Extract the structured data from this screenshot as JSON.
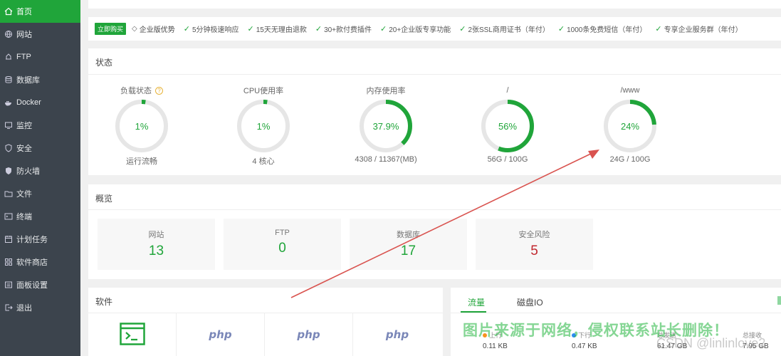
{
  "sidebar": {
    "items": [
      {
        "label": "首页",
        "icon": "home-icon",
        "active": true
      },
      {
        "label": "网站",
        "icon": "globe-icon"
      },
      {
        "label": "FTP",
        "icon": "ftp-icon"
      },
      {
        "label": "数据库",
        "icon": "database-icon"
      },
      {
        "label": "Docker",
        "icon": "docker-icon"
      },
      {
        "label": "监控",
        "icon": "monitor-icon"
      },
      {
        "label": "安全",
        "icon": "shield-icon"
      },
      {
        "label": "防火墙",
        "icon": "firewall-icon"
      },
      {
        "label": "文件",
        "icon": "folder-icon"
      },
      {
        "label": "终端",
        "icon": "terminal-icon"
      },
      {
        "label": "计划任务",
        "icon": "calendar-icon"
      },
      {
        "label": "软件商店",
        "icon": "apps-icon"
      },
      {
        "label": "面板设置",
        "icon": "settings-icon"
      },
      {
        "label": "退出",
        "icon": "logout-icon"
      }
    ]
  },
  "promo": {
    "buy_label": "立即购买",
    "enterprise_label": "企业版优势",
    "features": [
      "5分钟极速响应",
      "15天无理由退款",
      "30+款付费插件",
      "20+企业版专享功能",
      "2张SSL商用证书（年付）",
      "1000条免费短信（年付）",
      "专享企业服务群（年付）"
    ]
  },
  "status": {
    "title": "状态",
    "gauges": [
      {
        "label": "负载状态",
        "value": "1%",
        "percent": 1,
        "sub": "运行流畅",
        "help": "?"
      },
      {
        "label": "CPU使用率",
        "value": "1%",
        "percent": 1,
        "sub": "4 核心"
      },
      {
        "label": "内存使用率",
        "value": "37.9%",
        "percent": 37.9,
        "sub": "4308 / 11367(MB)"
      },
      {
        "label": "/",
        "value": "56%",
        "percent": 56,
        "sub": "56G / 100G"
      },
      {
        "label": "/www",
        "value": "24%",
        "percent": 24,
        "sub": "24G / 100G"
      }
    ]
  },
  "overview": {
    "title": "概览",
    "stats": [
      {
        "label": "网站",
        "value": "13"
      },
      {
        "label": "FTP",
        "value": "0"
      },
      {
        "label": "数据库",
        "value": "17"
      },
      {
        "label": "安全风险",
        "value": "5"
      }
    ]
  },
  "software": {
    "title": "软件",
    "items": [
      "terminal",
      "php",
      "php",
      "php"
    ]
  },
  "traffic": {
    "tabs": [
      "流量",
      "磁盘IO"
    ],
    "cols": [
      {
        "label": "上行",
        "value": "0.11 KB",
        "color": "#f7931e"
      },
      {
        "label": "下行",
        "value": "0.47 KB",
        "color": "#2d8cf0"
      },
      {
        "label": "总发送",
        "value": "61.47 GB"
      },
      {
        "label": "总接收",
        "value": "7.95 GB"
      }
    ]
  },
  "overlay": {
    "watermark": "图片来源于网络，侵权联系站长删除！",
    "csdn": "CSDN @linlinlove2"
  },
  "colors": {
    "accent": "#20a53a",
    "sidebar": "#3c444d",
    "danger": "#c1272d",
    "arrow": "#d9534f"
  }
}
